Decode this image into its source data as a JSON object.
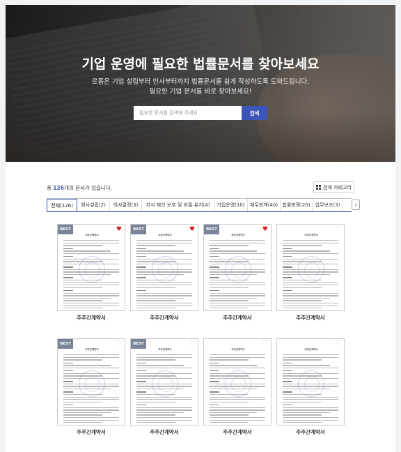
{
  "hero": {
    "title": "기업 운영에 필요한 법률문서를 찾아보세요",
    "subtitle_line1": "로폼은 기업 설립부터 인사부터까지 법률문서를 쉽게 작성하도록 도와드립니다.",
    "subtitle_line2": "필요한 기업 문서를 바로 찾아보세요!",
    "search_placeholder": "필요한 문서를 검색해 주세요.",
    "search_button": "검색"
  },
  "listing": {
    "count_prefix": "총",
    "count": "126",
    "count_suffix": "개의 문서가 있습니다.",
    "category_button": "전체 카테고리"
  },
  "tabs": [
    {
      "label": "전체(126)",
      "active": true
    },
    {
      "label": "회사설립(2)",
      "active": false
    },
    {
      "label": "의사결정(3)",
      "active": false
    },
    {
      "label": "지식 재산 보호 및 비밀 유지(4)",
      "active": false
    },
    {
      "label": "기업운영(10)",
      "active": false
    },
    {
      "label": "재무회계(40)",
      "active": false
    },
    {
      "label": "법률분쟁(20)",
      "active": false
    },
    {
      "label": "업무보조(3)",
      "active": false
    }
  ],
  "tab_next_icon": "chevron-right-icon",
  "documents": [
    {
      "name": "주주간계약서",
      "best": true,
      "liked": true
    },
    {
      "name": "주주간계약서",
      "best": true,
      "liked": true
    },
    {
      "name": "주주간계약서",
      "best": true,
      "liked": true
    },
    {
      "name": "주주간계약서",
      "best": false,
      "liked": false
    },
    {
      "name": "주주간계약서",
      "best": true,
      "liked": false
    },
    {
      "name": "주주간계약서",
      "best": true,
      "liked": false
    },
    {
      "name": "주주간계약서",
      "best": false,
      "liked": false
    },
    {
      "name": "주주간계약서",
      "best": false,
      "liked": false
    }
  ],
  "doc_thumbnail_title": "주주간계약서",
  "best_badge": "BEST",
  "colors": {
    "accent": "#3d55b8",
    "heart_on": "#e0211f",
    "badge": "#7a8497"
  }
}
